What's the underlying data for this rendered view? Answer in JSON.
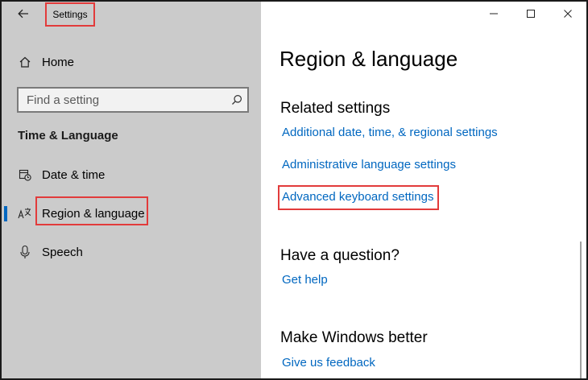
{
  "window": {
    "title": "Settings"
  },
  "titlebar": {
    "back_icon": "back-arrow-icon",
    "controls": [
      "minimize-icon",
      "maximize-icon",
      "close-icon"
    ]
  },
  "sidebar": {
    "home": {
      "label": "Home",
      "icon": "home-icon"
    },
    "search": {
      "placeholder": "Find a setting",
      "icon": "search-icon"
    },
    "section_title": "Time & Language",
    "items": [
      {
        "label": "Date & time",
        "icon": "calendar-clock-icon",
        "active": false
      },
      {
        "label": "Region & language",
        "icon": "language-icon",
        "active": true
      },
      {
        "label": "Speech",
        "icon": "microphone-icon",
        "active": false
      }
    ]
  },
  "main": {
    "title": "Region & language",
    "related": {
      "heading": "Related settings",
      "links": [
        "Additional date, time, & regional settings",
        "Administrative language settings",
        "Advanced keyboard settings"
      ]
    },
    "question": {
      "heading": "Have a question?",
      "link": "Get help"
    },
    "better": {
      "heading": "Make Windows better",
      "link": "Give us feedback"
    }
  },
  "colors": {
    "sidebar_bg": "#cbcbcb",
    "accent": "#0067c0",
    "highlight": "#e23b3b"
  }
}
